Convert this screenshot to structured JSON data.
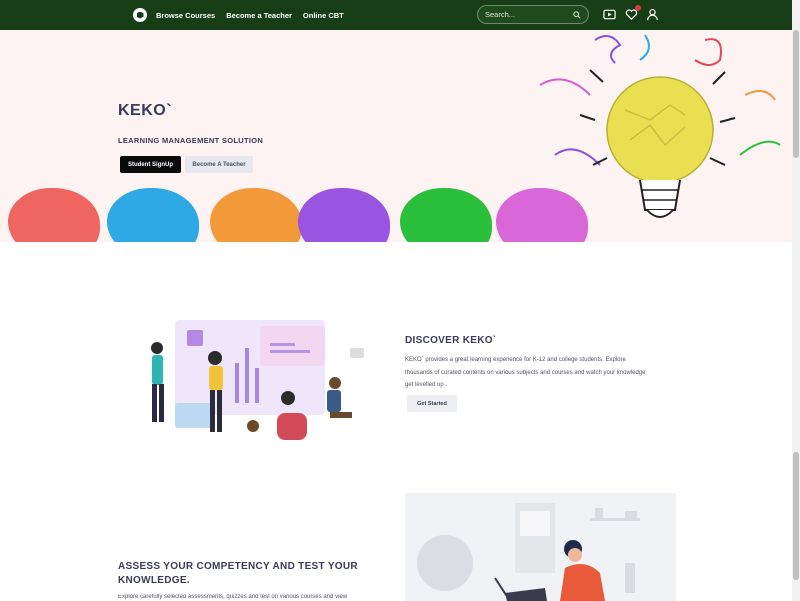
{
  "nav": {
    "links": [
      "Browse Courses",
      "Become a Teacher",
      "Online CBT"
    ],
    "search_placeholder": "Search...",
    "icons": [
      "video-play-icon",
      "heart-icon",
      "user-icon"
    ],
    "brand_color": "#173d17",
    "wishlist_badge_color": "#e0344a"
  },
  "hero": {
    "title": "KEKO`",
    "subtitle": "LEARNING MANAGEMENT SOLUTION",
    "primary_button": "Student SignUp",
    "secondary_button": "Become A Teacher",
    "paper_ball_colors": [
      "#ef6661",
      "#2fa8e6",
      "#f29a3a",
      "#9a55e0",
      "#2bc03c",
      "#d868d8"
    ],
    "bulb_color": "#e8e050"
  },
  "discover": {
    "title": "DISCOVER KEKO`",
    "text": "KEKO` provides a great learning experience for K-12 and college students. Explore thousands of curated contents on various subjects and courses and watch your knowledge get levelled up .",
    "button": "Get Started"
  },
  "assess": {
    "title_line1": "ASSESS YOUR COMPETENCY AND TEST YOUR",
    "title_line2": "KNOWLEDGE.",
    "text": "Explore carefully selected assessments, quizzes and test on various courses and view"
  }
}
